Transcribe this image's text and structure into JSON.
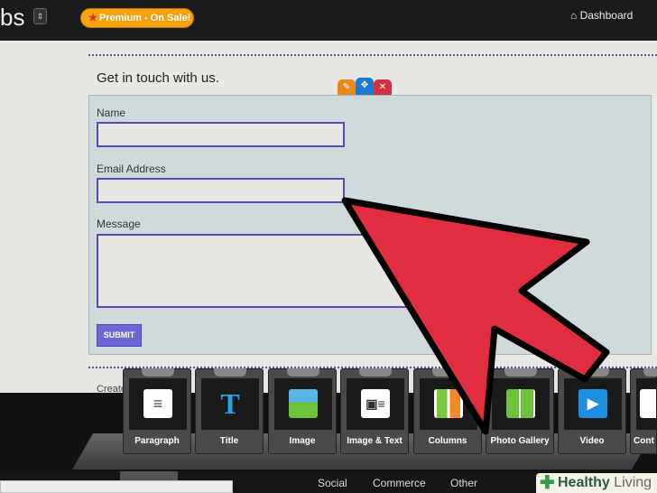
{
  "header": {
    "logo_fragment": "bs",
    "menu_icon": "updown-icon",
    "premium_label": "Premium - On Sale!",
    "dashboard_label": "Dashboard"
  },
  "form": {
    "heading": "Get in touch with us.",
    "fields": [
      {
        "label": "Name",
        "value": ""
      },
      {
        "label": "Email Address",
        "value": ""
      },
      {
        "label": "Message",
        "value": ""
      }
    ],
    "submit_label": "SUBMIT"
  },
  "footer_text": "Create",
  "elements": [
    {
      "label": "Paragraph",
      "icon": "paragraph-icon"
    },
    {
      "label": "Title",
      "icon": "title-icon"
    },
    {
      "label": "Image",
      "icon": "image-icon"
    },
    {
      "label": "Image & Text",
      "icon": "image-text-icon"
    },
    {
      "label": "Columns",
      "icon": "columns-icon"
    },
    {
      "label": "Photo Gallery",
      "icon": "gallery-icon"
    },
    {
      "label": "Video",
      "icon": "video-icon"
    },
    {
      "label": "Cont",
      "icon": "contact-icon"
    }
  ],
  "tabs": [
    "Social",
    "Commerce",
    "Other"
  ],
  "watermark": {
    "bold": "Healthy",
    "light": " Living"
  },
  "colors": {
    "arrow": "#e02d3f",
    "accent": "#5749b8",
    "premium": "#f5a20e"
  }
}
